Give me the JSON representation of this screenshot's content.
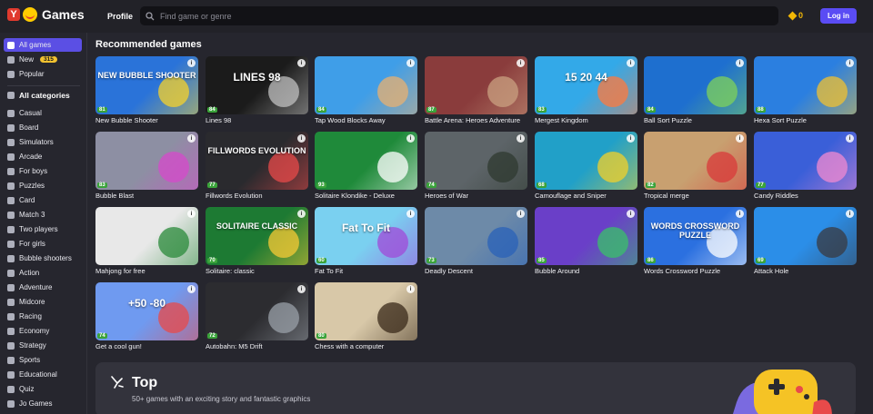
{
  "header": {
    "app_name": "Games",
    "profile_label": "Profile",
    "search_placeholder": "Find game or genre",
    "coins": "0",
    "login_label": "Log in"
  },
  "sidebar": {
    "top_items": [
      {
        "label": "All games",
        "icon": "grid-icon",
        "active": true
      },
      {
        "label": "New",
        "icon": "star-icon",
        "badge": "315"
      },
      {
        "label": "Popular",
        "icon": "flame-icon"
      }
    ],
    "categories_heading": "All categories",
    "categories": [
      "Casual",
      "Board",
      "Simulators",
      "Arcade",
      "For boys",
      "Puzzles",
      "Card",
      "Match 3",
      "Two players",
      "For girls",
      "Bubble shooters",
      "Action",
      "Adventure",
      "Midcore",
      "Racing",
      "Economy",
      "Strategy",
      "Sports",
      "Educational",
      "Quiz",
      "Jo Games"
    ]
  },
  "section": {
    "title": "Recommended games",
    "games": [
      {
        "title": "New Bubble Shooter",
        "rating": "81",
        "thumb_text": "NEW BUBBLE SHOOTER",
        "bg": "#2a73d9",
        "accent": "#f6d22b"
      },
      {
        "title": "Lines 98",
        "rating": "84",
        "thumb_text": "LINES 98",
        "bg": "#1b1b1b",
        "accent": "#c0c0c0"
      },
      {
        "title": "Tap Wood Blocks Away",
        "rating": "84",
        "thumb_text": "",
        "bg": "#3f9ee8",
        "accent": "#e8b070"
      },
      {
        "title": "Battle Arena: Heroes Adventure",
        "rating": "87",
        "thumb_text": "",
        "bg": "#8a3c3c",
        "accent": "#c9a080"
      },
      {
        "title": "Mergest Kingdom",
        "rating": "83",
        "thumb_text": "15  20  44",
        "bg": "#33a9e8",
        "accent": "#ff7a3d"
      },
      {
        "title": "Ball Sort Puzzle",
        "rating": "84",
        "thumb_text": "",
        "bg": "#1e6fcf",
        "accent": "#7fd25a"
      },
      {
        "title": "Hexa Sort Puzzle",
        "rating": "88",
        "thumb_text": "",
        "bg": "#2b7fe0",
        "accent": "#f0c030"
      },
      {
        "title": "Bubble Blast",
        "rating": "83",
        "thumb_text": "",
        "bg": "#8d8fa3",
        "accent": "#d64acb"
      },
      {
        "title": "Fillwords Evolution",
        "rating": "77",
        "thumb_text": "FILLWORDS EVOLUTION",
        "bg": "#2a2a2e",
        "accent": "#e84a4a"
      },
      {
        "title": "Solitaire Klondike - Deluxe",
        "rating": "93",
        "thumb_text": "",
        "bg": "#1f8a3a",
        "accent": "#ffffff"
      },
      {
        "title": "Heroes of War",
        "rating": "74",
        "thumb_text": "",
        "bg": "#5d6468",
        "accent": "#2f3a30"
      },
      {
        "title": "Camouflage and Sniper",
        "rating": "68",
        "thumb_text": "",
        "bg": "#21a0c8",
        "accent": "#f2d02a"
      },
      {
        "title": "Tropical merge",
        "rating": "82",
        "thumb_text": "",
        "bg": "#c8a070",
        "accent": "#d83a3a"
      },
      {
        "title": "Candy Riddles",
        "rating": "77",
        "thumb_text": "",
        "bg": "#3a5fd8",
        "accent": "#f28ad0"
      },
      {
        "title": "Mahjong for free",
        "rating": "",
        "thumb_text": "",
        "bg": "#e8e8e8",
        "accent": "#2a8a3a"
      },
      {
        "title": "Solitaire: classic",
        "rating": "70",
        "thumb_text": "SOLITAIRE CLASSIC",
        "bg": "#1d7a33",
        "accent": "#f7c935"
      },
      {
        "title": "Fat To Fit",
        "rating": "60",
        "thumb_text": "Fat To Fit",
        "bg": "#7ad0f0",
        "accent": "#a04ad8"
      },
      {
        "title": "Deadly Descent",
        "rating": "73",
        "thumb_text": "",
        "bg": "#6d8aa8",
        "accent": "#2a62b8"
      },
      {
        "title": "Bubble Around",
        "rating": "85",
        "thumb_text": "",
        "bg": "#6a3fc8",
        "accent": "#3ac06a"
      },
      {
        "title": "Words Crossword Puzzle",
        "rating": "86",
        "thumb_text": "WORDS CROSSWORD PUZZLE",
        "bg": "#2b70e0",
        "accent": "#ffffff"
      },
      {
        "title": "Attack Hole",
        "rating": "69",
        "thumb_text": "",
        "bg": "#2b8ee8",
        "accent": "#3a3a40"
      },
      {
        "title": "Get a cool gun!",
        "rating": "74",
        "thumb_text": "+50  -80",
        "bg": "#6f9af0",
        "accent": "#e84a4a"
      },
      {
        "title": "Autobahn: M5 Drift",
        "rating": "72",
        "thumb_text": "",
        "bg": "#2c2c30",
        "accent": "#9aa0a8"
      },
      {
        "title": "Chess with a computer",
        "rating": "80",
        "thumb_text": "",
        "bg": "#d8c8a8",
        "accent": "#3a2a1a"
      }
    ]
  },
  "top_banner": {
    "title": "Top",
    "subtitle": "50+ games with an exciting story and fantastic graphics"
  }
}
